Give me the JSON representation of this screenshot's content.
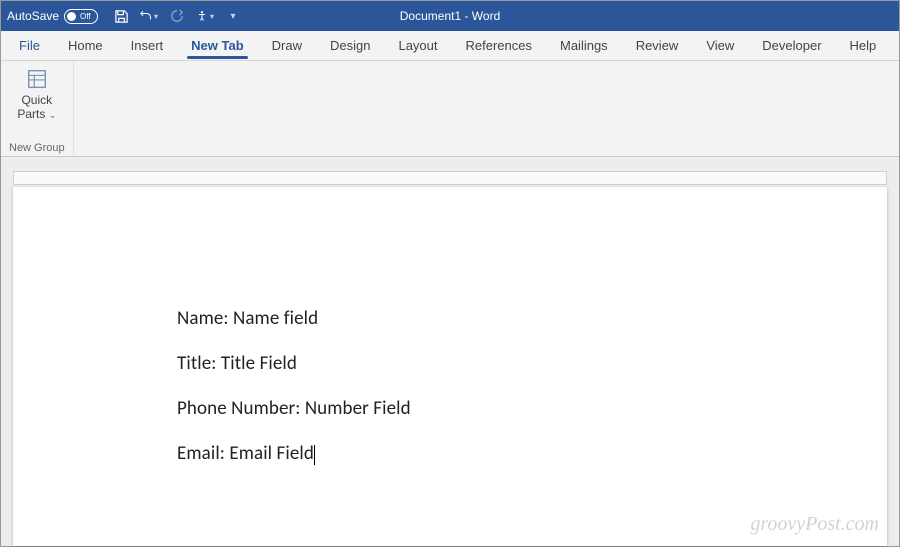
{
  "titlebar": {
    "autosave_label": "AutoSave",
    "autosave_state": "Off",
    "title": "Document1  -  Word"
  },
  "tabs": {
    "file": "File",
    "home": "Home",
    "insert": "Insert",
    "newtab": "New Tab",
    "draw": "Draw",
    "design": "Design",
    "layout": "Layout",
    "references": "References",
    "mailings": "Mailings",
    "review": "Review",
    "view": "View",
    "developer": "Developer",
    "help": "Help"
  },
  "ribbon": {
    "quickparts_line1": "Quick",
    "quickparts_line2": "Parts",
    "group_name": "New Group"
  },
  "document": {
    "lines": [
      "Name: Name field",
      "Title: Title Field",
      "Phone Number: Number Field",
      "Email: Email Field"
    ]
  },
  "watermark": "groovyPost.com"
}
